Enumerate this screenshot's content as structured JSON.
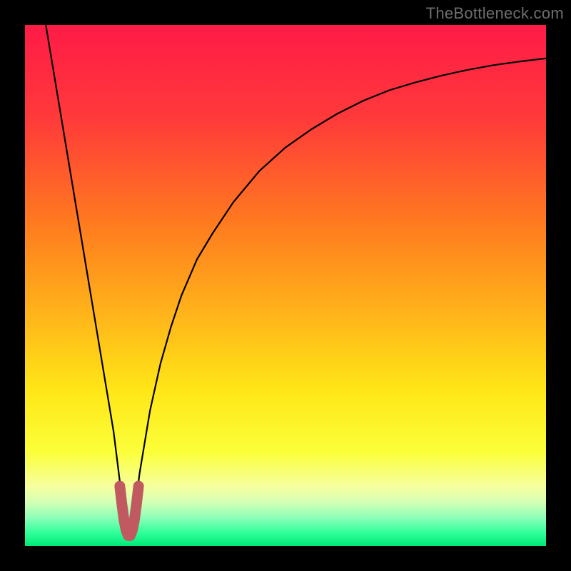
{
  "watermark": "TheBottleneck.com",
  "colors": {
    "bg_frame": "#000000",
    "gradient_stops": [
      {
        "offset": 0.0,
        "color": "#ff1b47"
      },
      {
        "offset": 0.18,
        "color": "#ff3a3a"
      },
      {
        "offset": 0.38,
        "color": "#ff7a1f"
      },
      {
        "offset": 0.55,
        "color": "#ffb21a"
      },
      {
        "offset": 0.7,
        "color": "#ffe617"
      },
      {
        "offset": 0.82,
        "color": "#fbff3a"
      },
      {
        "offset": 0.885,
        "color": "#f6ff9e"
      },
      {
        "offset": 0.915,
        "color": "#d6ffb4"
      },
      {
        "offset": 0.945,
        "color": "#8fffb8"
      },
      {
        "offset": 0.975,
        "color": "#2fff9a"
      },
      {
        "offset": 1.0,
        "color": "#00e876"
      }
    ],
    "curve": "#000000",
    "marker_fill": "#c05a60",
    "marker_stroke": "#c05a60"
  },
  "chart_data": {
    "type": "line",
    "title": "",
    "xlabel": "",
    "ylabel": "",
    "xlim": [
      0,
      100
    ],
    "ylim": [
      0,
      100
    ],
    "x_optimum": 20,
    "series": [
      {
        "name": "bottleneck-curve",
        "x": [
          4,
          6,
          8,
          10,
          12,
          14,
          15,
          16,
          17,
          18,
          18.5,
          19,
          19.5,
          20,
          20.5,
          21,
          21.5,
          22,
          23,
          24,
          26,
          28,
          30,
          33,
          36,
          40,
          45,
          50,
          55,
          60,
          65,
          70,
          75,
          80,
          85,
          90,
          95,
          100
        ],
        "y": [
          100,
          88,
          76,
          64,
          52,
          40,
          34,
          28,
          22,
          14,
          10,
          6,
          3,
          1.5,
          3,
          6,
          10,
          14,
          20,
          26,
          35,
          42,
          48,
          55,
          60,
          66,
          72,
          76.5,
          80,
          83,
          85.5,
          87.5,
          89,
          90.3,
          91.4,
          92.3,
          93,
          93.6
        ]
      }
    ],
    "markers": {
      "name": "optimum-U",
      "x": [
        18.2,
        18.6,
        19.0,
        19.4,
        19.8,
        20.2,
        20.6,
        21.0,
        21.4,
        21.8
      ],
      "y": [
        11.5,
        8.0,
        5.0,
        3.0,
        2.0,
        2.0,
        3.0,
        5.0,
        8.0,
        11.5
      ]
    }
  }
}
